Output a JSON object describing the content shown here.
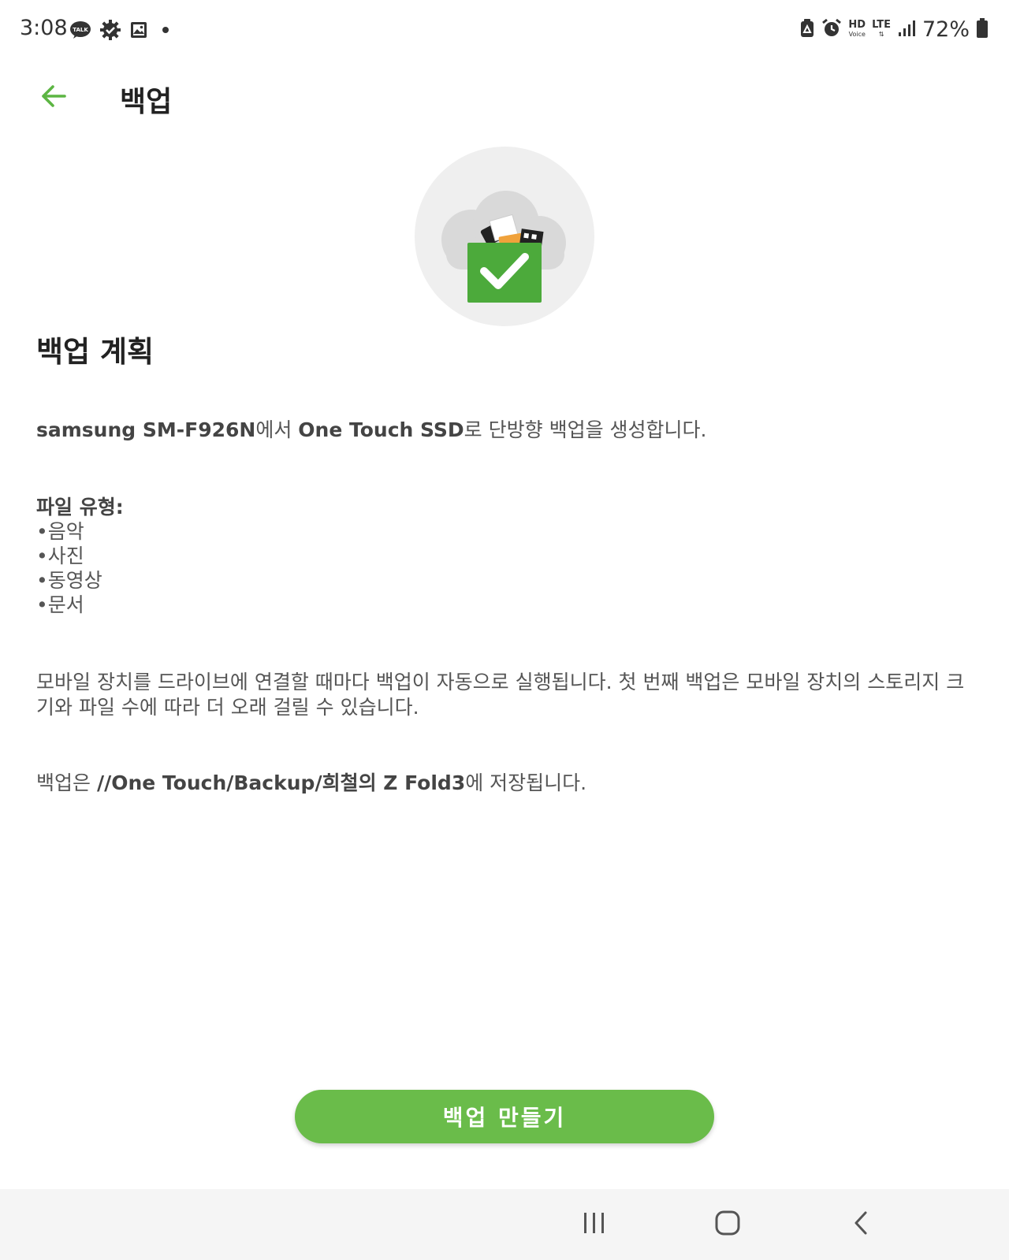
{
  "status_bar": {
    "time": "3:08",
    "left_icons": [
      "kakaotalk-icon",
      "settings-badge-icon",
      "gallery-icon",
      "dot-icon"
    ],
    "kakao_label": "TALK",
    "hd_label": "HD",
    "voice_label": "Voice",
    "lte_label": "LTE",
    "battery_percent": "72%",
    "right_icons": [
      "recycle-icon",
      "alarm-icon",
      "hd-voice-icon",
      "lte-icon",
      "signal-icon",
      "battery-icon"
    ]
  },
  "app_bar": {
    "title": "백업",
    "back_icon": "back-arrow-icon"
  },
  "hero": {
    "icon": "backup-folder-check-icon"
  },
  "plan": {
    "title": "백업 계획",
    "summary": {
      "device": "samsung SM-F926N",
      "text1": "에서 ",
      "target": "One Touch SSD",
      "text2": "로 단방향 백업을 생성합니다."
    },
    "file_types_label": "파일 유형:",
    "file_types": [
      "음악",
      "사진",
      "동영상",
      "문서"
    ],
    "auto_note": "모바일 장치를 드라이브에 연결할 때마다 백업이 자동으로 실행됩니다. 첫 번째 백업은 모바일 장치의 스토리지 크기와 파일 수에 따라 더 오래 걸릴 수 있습니다.",
    "location": {
      "prefix": "백업은 ",
      "path": "//One Touch/Backup/희철의 Z Fold3",
      "suffix": "에 저장됩니다."
    }
  },
  "actions": {
    "create_backup_label": "백업 만들기"
  },
  "nav_bar": {
    "icons": [
      "recent-apps-icon",
      "home-icon",
      "back-icon"
    ]
  },
  "colors": {
    "accent": "#6abc4a",
    "folder_green": "#4caa3b",
    "hero_bg": "#efefef",
    "navbar_bg": "#f5f5f5"
  }
}
